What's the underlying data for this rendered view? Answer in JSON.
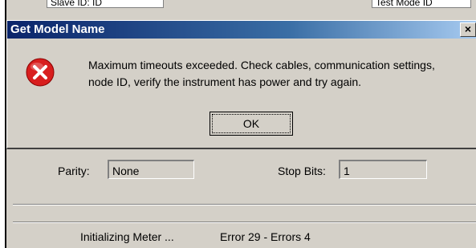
{
  "background": {
    "top_left_label": "Slave ID: ID",
    "top_right_label": "Test Mode ID",
    "parity_label": "Parity:",
    "parity_value": "None",
    "stopbits_label": "Stop Bits:",
    "stopbits_value": "1",
    "status_text": "Initializing Meter ...",
    "error_text": "Error 29 - Errors 4"
  },
  "dialog": {
    "title": "Get Model Name",
    "close_glyph": "×",
    "message_line1": "Maximum timeouts exceeded. Check cables, communication settings,",
    "message_line2": "node ID, verify the instrument has power and try again.",
    "ok_label": "OK",
    "icon": "error-icon"
  }
}
